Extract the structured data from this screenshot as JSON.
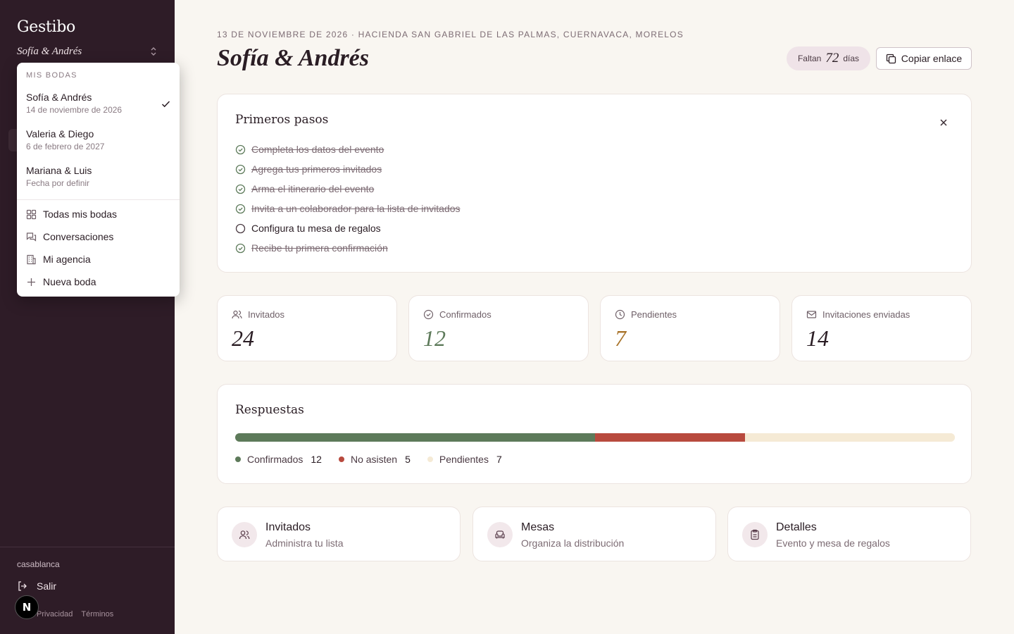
{
  "sidebar": {
    "brand": "Gestibo",
    "current_wedding": "Sofía & Andrés",
    "org_name": "casablanca",
    "logout_label": "Salir",
    "legal": {
      "privacy": "Privacidad",
      "terms": "Términos"
    },
    "badge_letter": "N"
  },
  "dropdown": {
    "section_label": "MIS BODAS",
    "weddings": [
      {
        "name": "Sofía & Andrés",
        "date": "14 de noviembre de 2026",
        "selected": true
      },
      {
        "name": "Valeria & Diego",
        "date": "6 de febrero de 2027",
        "selected": false
      },
      {
        "name": "Mariana & Luis",
        "date": "Fecha por definir",
        "selected": false
      }
    ],
    "actions": [
      {
        "label": "Todas mis bodas",
        "icon": "grid-icon"
      },
      {
        "label": "Conversaciones",
        "icon": "chat-icon"
      },
      {
        "label": "Mi agencia",
        "icon": "building-icon"
      },
      {
        "label": "Nueva boda",
        "icon": "plus-icon"
      }
    ]
  },
  "header": {
    "eyebrow": "13 DE NOVIEMBRE DE 2026 · HACIENDA SAN GABRIEL DE LAS PALMAS, CUERNAVACA, MORELOS",
    "title": "Sofía & Andrés",
    "countdown": {
      "prefix": "Faltan",
      "value": "72",
      "suffix": "días"
    },
    "copy_label": "Copiar enlace"
  },
  "steps": {
    "title": "Primeros pasos",
    "items": [
      {
        "label": "Completa los datos del evento",
        "done": true
      },
      {
        "label": "Agrega tus primeros invitados",
        "done": true
      },
      {
        "label": "Arma el itinerario del evento",
        "done": true
      },
      {
        "label": "Invita a un colaborador para la lista de invitados",
        "done": true
      },
      {
        "label": "Configura tu mesa de regalos",
        "done": false
      },
      {
        "label": "Recibe tu primera confirmación",
        "done": true
      }
    ]
  },
  "stats": [
    {
      "label": "Invitados",
      "value": "24",
      "icon": "users-icon",
      "color": "#2a1d24"
    },
    {
      "label": "Confirmados",
      "value": "12",
      "icon": "check-circle-icon",
      "color": "#5d7a5a"
    },
    {
      "label": "Pendientes",
      "value": "7",
      "icon": "clock-icon",
      "color": "#a8732a"
    },
    {
      "label": "Invitaciones enviadas",
      "value": "14",
      "icon": "mail-icon",
      "color": "#2a1d24"
    }
  ],
  "responses": {
    "title": "Respuestas",
    "total": 24,
    "segments": [
      {
        "label": "Confirmados",
        "count": 12,
        "color": "#5d7a5a"
      },
      {
        "label": "No asisten",
        "count": 5,
        "color": "#b84a3e"
      },
      {
        "label": "Pendientes",
        "count": 7,
        "color": "#f5ead5"
      }
    ]
  },
  "nav_cards": [
    {
      "title": "Invitados",
      "subtitle": "Administra tu lista",
      "icon": "users-icon"
    },
    {
      "title": "Mesas",
      "subtitle": "Organiza la distribución",
      "icon": "sofa-icon"
    },
    {
      "title": "Detalles",
      "subtitle": "Evento y mesa de regalos",
      "icon": "clipboard-icon"
    }
  ]
}
